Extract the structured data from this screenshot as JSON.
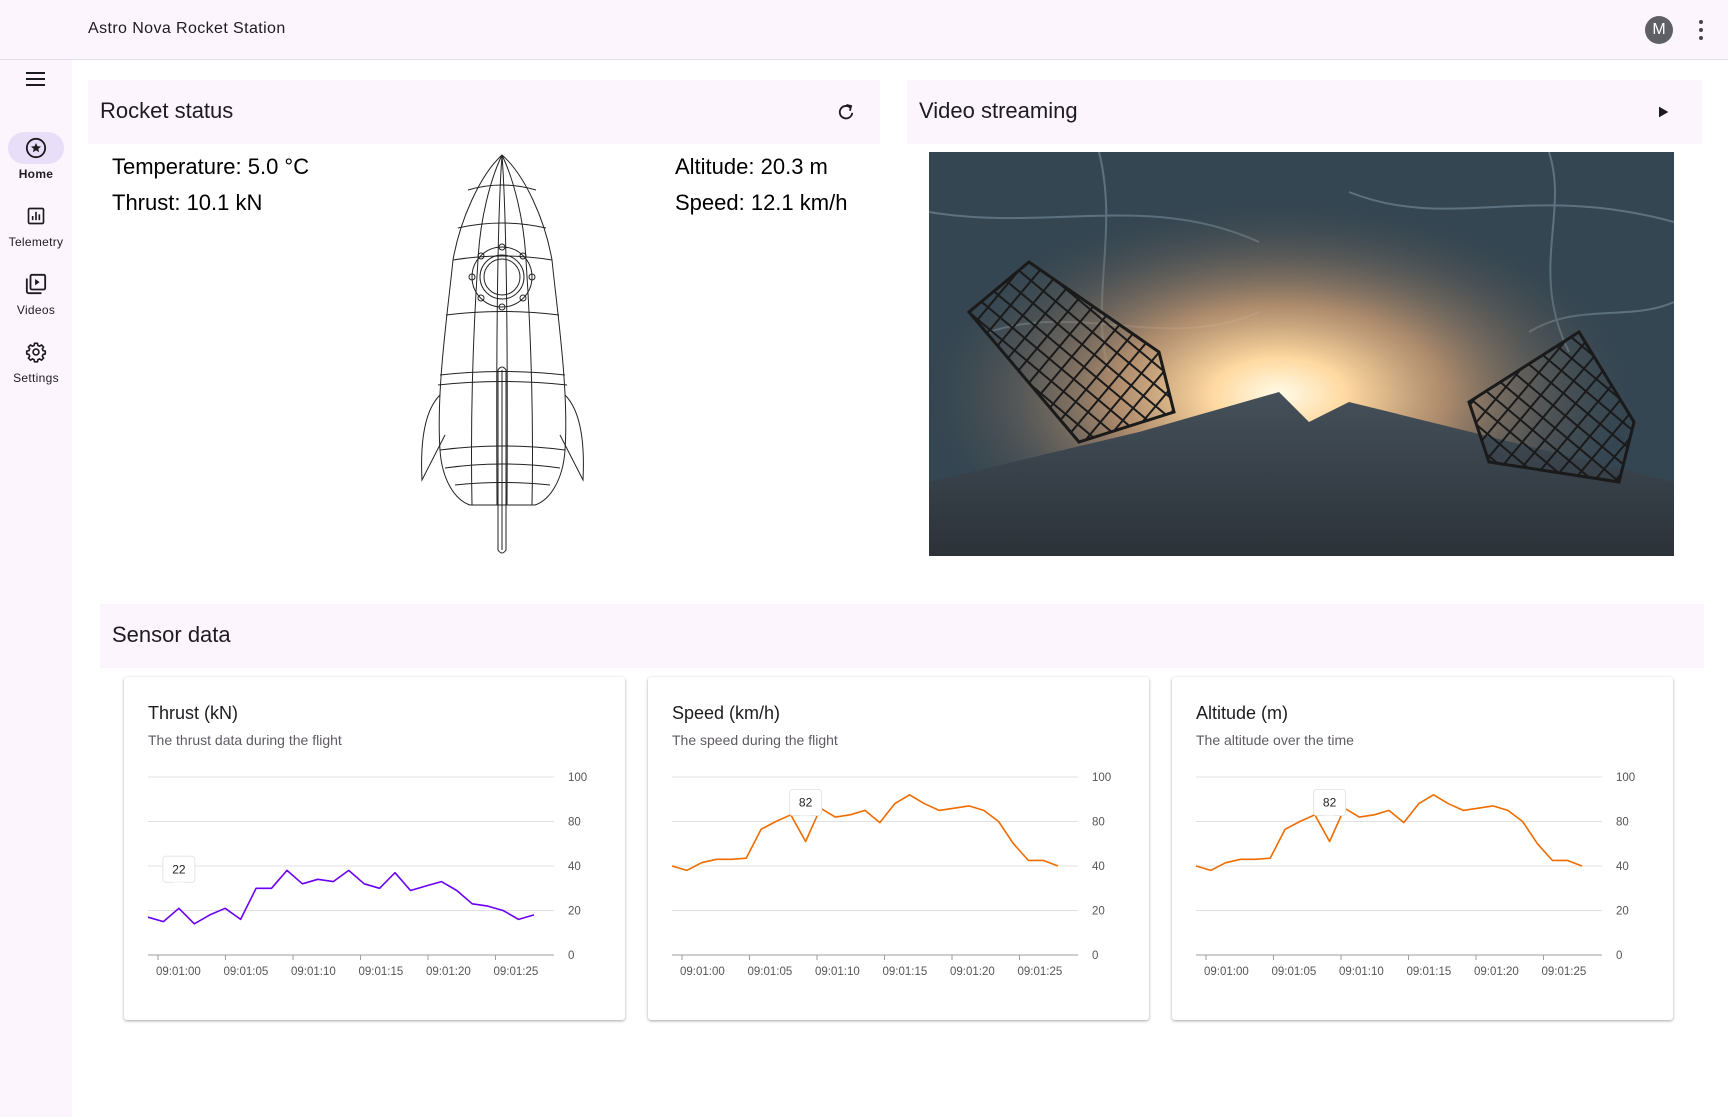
{
  "app": {
    "title": "Astro Nova Rocket Station",
    "avatar_initial": "M"
  },
  "nav": {
    "items": [
      {
        "label": "Home",
        "icon": "star-circle-icon",
        "active": true
      },
      {
        "label": "Telemetry",
        "icon": "bar-chart-icon",
        "active": false
      },
      {
        "label": "Videos",
        "icon": "video-library-icon",
        "active": false
      },
      {
        "label": "Settings",
        "icon": "gear-icon",
        "active": false
      }
    ]
  },
  "rocket_status": {
    "title": "Rocket status",
    "temperature": "Temperature: 5.0 °C",
    "thrust": "Thrust: 10.1 kN",
    "altitude": "Altitude: 20.3 m",
    "speed": "Speed: 12.1 km/h"
  },
  "video": {
    "title": "Video streaming"
  },
  "sensor": {
    "title": "Sensor data",
    "cards": [
      {
        "title": "Thrust (kN)",
        "subtitle": "The thrust data during the flight"
      },
      {
        "title": "Speed (km/h)",
        "subtitle": "The speed during the flight"
      },
      {
        "title": "Altitude (m)",
        "subtitle": "The altitude over the time"
      }
    ]
  },
  "colors": {
    "accent": "#e8def8",
    "thrust_line": "#6a00f4",
    "speed_line": "#ef6c00",
    "altitude_line": "#ef6c00",
    "surface": "#fdf5fd"
  },
  "chart_data": [
    {
      "type": "line",
      "title": "Thrust (kN)",
      "subtitle": "The thrust data during the flight",
      "x_ticks": [
        "09:01:00",
        "09:01:05",
        "09:01:10",
        "09:01:15",
        "09:01:20",
        "09:01:25"
      ],
      "y_ticks": [
        0,
        20,
        40,
        80,
        100
      ],
      "ylim": [
        0,
        100
      ],
      "grid": true,
      "color": "#6a00f4",
      "tooltip": {
        "index": 2,
        "value": "22"
      },
      "values": [
        17,
        15,
        21,
        14,
        18,
        21,
        16,
        30,
        30,
        38,
        32,
        34,
        33,
        38,
        32,
        30,
        37,
        29,
        31,
        33,
        29,
        23,
        22,
        20,
        16,
        18
      ]
    },
    {
      "type": "line",
      "title": "Speed (km/h)",
      "subtitle": "The speed during the flight",
      "x_ticks": [
        "09:01:00",
        "09:01:05",
        "09:01:10",
        "09:01:15",
        "09:01:20",
        "09:01:25"
      ],
      "y_ticks": [
        0,
        20,
        40,
        80,
        100
      ],
      "ylim": [
        0,
        100
      ],
      "grid": true,
      "color": "#ef6c00",
      "tooltip": {
        "index": 9,
        "value": "82"
      },
      "values": [
        40,
        38,
        43,
        46,
        46,
        47,
        73,
        80,
        83,
        62,
        86,
        82,
        83,
        85,
        79,
        88,
        92,
        88,
        85,
        86,
        87,
        85,
        80,
        60,
        45,
        45,
        40
      ]
    },
    {
      "type": "line",
      "title": "Altitude (m)",
      "subtitle": "The altitude over the time",
      "x_ticks": [
        "09:01:00",
        "09:01:05",
        "09:01:10",
        "09:01:15",
        "09:01:20",
        "09:01:25"
      ],
      "y_ticks": [
        0,
        20,
        40,
        80,
        100
      ],
      "ylim": [
        0,
        100
      ],
      "grid": true,
      "color": "#ef6c00",
      "tooltip": {
        "index": 9,
        "value": "82"
      },
      "values": [
        40,
        38,
        43,
        46,
        46,
        47,
        73,
        80,
        83,
        62,
        86,
        82,
        83,
        85,
        79,
        88,
        92,
        88,
        85,
        86,
        87,
        85,
        80,
        60,
        45,
        45,
        40
      ]
    }
  ]
}
